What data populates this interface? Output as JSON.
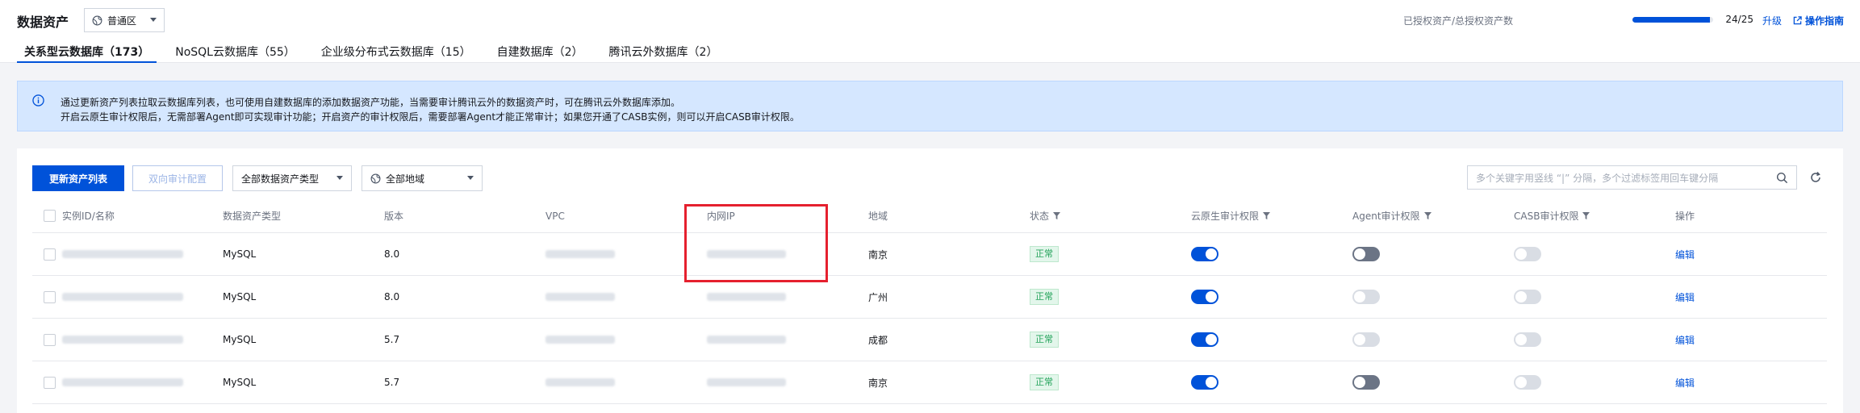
{
  "header": {
    "title": "数据资产",
    "region": "普通区",
    "quota_label": "已授权资产/总授权资产数",
    "quota_count": "24/25",
    "quota_fraction": 0.96,
    "upgrade": "升级",
    "guide": "操作指南"
  },
  "tabs": [
    {
      "label": "关系型云数据库（173）"
    },
    {
      "label": "NoSQL云数据库（55）"
    },
    {
      "label": "企业级分布式云数据库（15）"
    },
    {
      "label": "自建数据库（2）"
    },
    {
      "label": "腾讯云外数据库（2）"
    }
  ],
  "notice": {
    "line1": "通过更新资产列表拉取云数据库列表，也可使用自建数据库的添加数据资产功能，当需要审计腾讯云外的数据资产时，可在腾讯云外数据库添加。",
    "line2": "开启云原生审计权限后，无需部署Agent即可实现审计功能；开启资产的审计权限后，需要部署Agent才能正常审计；如果您开通了CASB实例，则可以开启CASB审计权限。"
  },
  "toolbar": {
    "update_label": "更新资产列表",
    "bidirectional_label": "双向审计配置",
    "type_select": "全部数据资产类型",
    "region_select": "全部地域",
    "search_placeholder": "多个关键字用竖线 “|” 分隔，多个过滤标签用回车键分隔"
  },
  "table": {
    "headers": {
      "id": "实例ID/名称",
      "type": "数据资产类型",
      "version": "版本",
      "vpc": "VPC",
      "ip": "内网IP",
      "region": "地域",
      "status": "状态",
      "cloud_audit": "云原生审计权限",
      "agent_audit": "Agent审计权限",
      "casb_audit": "CASB审计权限",
      "action": "操作"
    },
    "rows": [
      {
        "type": "MySQL",
        "version": "8.0",
        "region": "南京",
        "status": "正常",
        "cloud": "on",
        "agent": "dark",
        "casb": "off",
        "action": "编辑"
      },
      {
        "type": "MySQL",
        "version": "8.0",
        "region": "广州",
        "status": "正常",
        "cloud": "on",
        "agent": "off",
        "casb": "off",
        "action": "编辑"
      },
      {
        "type": "MySQL",
        "version": "5.7",
        "region": "成都",
        "status": "正常",
        "cloud": "on",
        "agent": "off",
        "casb": "off",
        "action": "编辑"
      },
      {
        "type": "MySQL",
        "version": "5.7",
        "region": "南京",
        "status": "正常",
        "cloud": "on",
        "agent": "dark",
        "casb": "off",
        "action": "编辑"
      }
    ]
  },
  "colors": {
    "accent": "#0052d9",
    "notice_bg": "#d5e7ff",
    "status_green": "#23a35a",
    "highlight_red": "#e5202e"
  }
}
